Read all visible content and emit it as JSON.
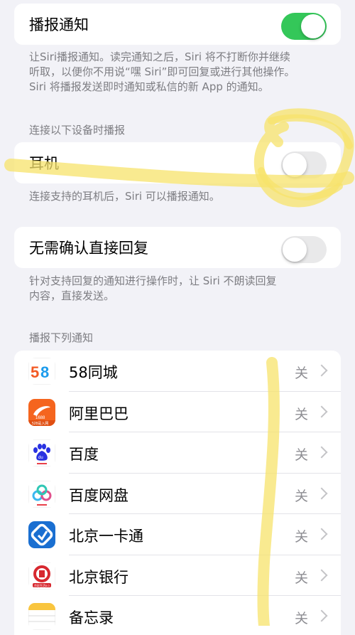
{
  "announce": {
    "label": "播报通知",
    "enabled": true
  },
  "announce_footer": [
    "让Siri播报通知。读完通知之后，Siri 将不打断你并继续",
    "听取，以便你不用说“嘿 Siri”即可回复或进行其他操作。",
    "Siri 将播报发送即时通知或私信的新 App 的通知。"
  ],
  "devices_header": "连接以下设备时播报",
  "headphones": {
    "label": "耳机",
    "enabled": false
  },
  "headphones_footer": "连接支持的耳机后，Siri 可以播报通知。",
  "reply": {
    "label": "无需确认直接回复",
    "enabled": false
  },
  "reply_footer": [
    "针对支持回复的通知进行操作时，让 Siri 不朗读回复",
    "内容，直接发送。"
  ],
  "apps_header": "播报下列通知",
  "apps": [
    {
      "name": "58同城",
      "state": "关",
      "icon": "58-tongcheng-icon"
    },
    {
      "name": "阿里巴巴",
      "state": "关",
      "icon": "alibaba-icon"
    },
    {
      "name": "百度",
      "state": "关",
      "icon": "baidu-paw-icon"
    },
    {
      "name": "百度网盘",
      "state": "关",
      "icon": "baidu-netdisk-icon"
    },
    {
      "name": "北京一卡通",
      "state": "关",
      "icon": "beijing-card-icon"
    },
    {
      "name": "北京银行",
      "state": "关",
      "icon": "bank-of-beijing-icon"
    },
    {
      "name": "备忘录",
      "state": "关",
      "icon": "notes-icon"
    }
  ],
  "icon_texts": {
    "alibaba_1688": "1688",
    "alibaba_sub": "528是入网",
    "baidu_du": "du",
    "bank_sub": "京彩生活6.0"
  },
  "colors": {
    "toggle_on": "#34c759",
    "toggle_off": "#e9e9ea",
    "highlighter": "#f7e36b",
    "background": "#f2f2f7"
  }
}
